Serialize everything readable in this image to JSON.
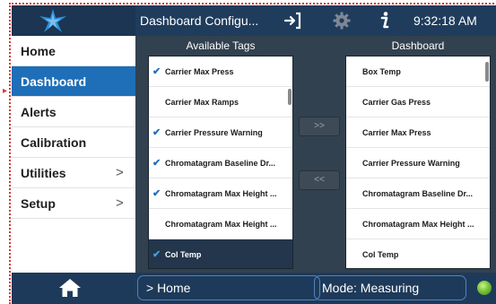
{
  "header": {
    "title": "Dashboard Configu...",
    "time": "9:32:18 AM",
    "icons": [
      "logo-star-icon",
      "exit-icon",
      "gear-icon",
      "info-icon"
    ]
  },
  "sidebar": {
    "items": [
      {
        "label": "Home",
        "active": false,
        "has_submenu": false
      },
      {
        "label": "Dashboard",
        "active": true,
        "has_submenu": false
      },
      {
        "label": "Alerts",
        "active": false,
        "has_submenu": false
      },
      {
        "label": "Calibration",
        "active": false,
        "has_submenu": false
      },
      {
        "label": "Utilities",
        "active": false,
        "has_submenu": true,
        "chevron": ">"
      },
      {
        "label": "Setup",
        "active": false,
        "has_submenu": true,
        "chevron": ">"
      }
    ]
  },
  "available_tags": {
    "title": "Available Tags",
    "items": [
      {
        "label": "Carrier Max Press",
        "checked": true,
        "selected": false
      },
      {
        "label": "Carrier Max Ramps",
        "checked": false,
        "selected": false
      },
      {
        "label": "Carrier Pressure Warning",
        "checked": true,
        "selected": false
      },
      {
        "label": "Chromatagram Baseline Dr...",
        "checked": true,
        "selected": false
      },
      {
        "label": "Chromatagram Max Height ...",
        "checked": true,
        "selected": false
      },
      {
        "label": "Chromatagram Max Height ...",
        "checked": false,
        "selected": false
      },
      {
        "label": "Col Temp",
        "checked": true,
        "selected": true
      }
    ]
  },
  "dashboard": {
    "title": "Dashboard",
    "items": [
      {
        "label": "Box Temp"
      },
      {
        "label": "Carrier Gas Press"
      },
      {
        "label": "Carrier Max Press"
      },
      {
        "label": "Carrier Pressure Warning"
      },
      {
        "label": "Chromatagram Baseline Dr..."
      },
      {
        "label": "Chromatagram Max Height ..."
      },
      {
        "label": "Col Temp"
      }
    ]
  },
  "buttons": {
    "add_label": ">>",
    "remove_label": "<<"
  },
  "footer": {
    "path": "> Home",
    "mode": "Mode: Measuring",
    "status_color": "#6cc43a"
  },
  "colors": {
    "header_bg": "#1f3c5c",
    "accent": "#1e6fb8",
    "screen_bg": "#32414f"
  }
}
